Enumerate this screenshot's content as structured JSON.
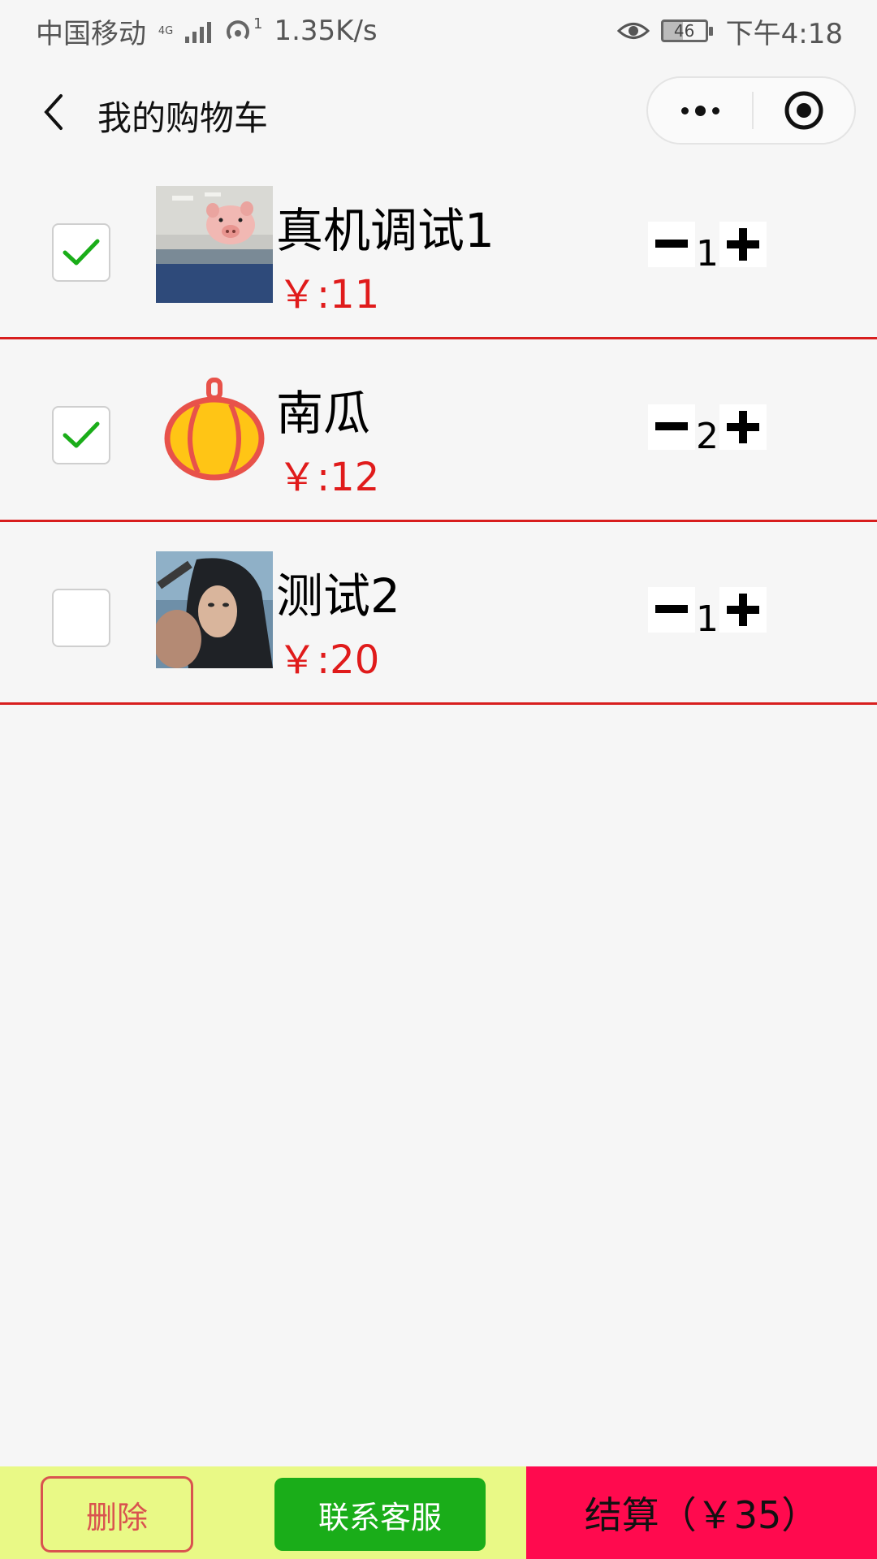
{
  "status_bar": {
    "carrier": "中国移动",
    "network": "4G",
    "hotspot_count": "1",
    "speed": "1.35K/s",
    "battery": "46",
    "time": "下午4:18"
  },
  "nav": {
    "title": "我的购物车",
    "icons": {
      "back": "chevron-left-icon",
      "more": "more-dots-icon",
      "close": "target-circle-icon"
    }
  },
  "cart": {
    "items": [
      {
        "name": "真机调试1",
        "price": "￥:11",
        "quantity": "1",
        "checked": true,
        "thumb": "pig-photo"
      },
      {
        "name": "南瓜",
        "price": "￥:12",
        "quantity": "2",
        "checked": true,
        "thumb": "pumpkin-icon"
      },
      {
        "name": "测试2",
        "price": "￥:20",
        "quantity": "1",
        "checked": false,
        "thumb": "girl-photo"
      }
    ],
    "divider_color": "#d81e1e",
    "price_color": "#e01b1b"
  },
  "bottom": {
    "delete_label": "删除",
    "contact_label": "联系客服",
    "checkout_label": "结算（￥35）",
    "colors": {
      "bar": "#e9f986",
      "contact": "#1aad19",
      "checkout": "#ff0a4e",
      "delete": "#d9534f"
    }
  }
}
